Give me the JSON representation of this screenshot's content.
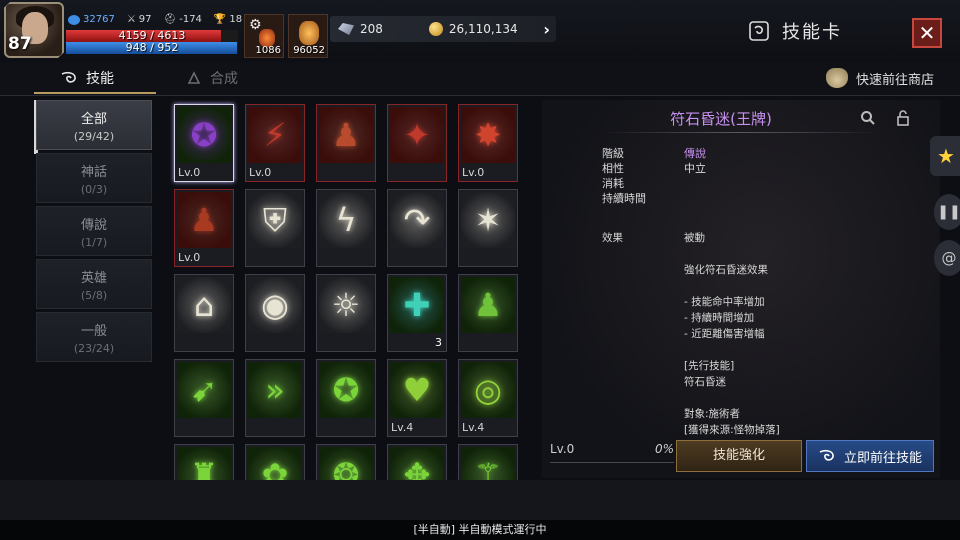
{
  "hud": {
    "level": "87",
    "combat_power": "32767",
    "stat_attack": "97",
    "stat_defense": "-174",
    "stat_trophy": "18",
    "hp_text": "4159 / 4613",
    "hp_fraction": 0.9,
    "mp_text": "948 / 952",
    "mp_fraction": 0.995,
    "potion1_count": "1086",
    "potion2_count": "96052",
    "crystal": "208",
    "gold": "26,110,134"
  },
  "header": {
    "title": "技能卡",
    "close_label": "✕"
  },
  "tabs": [
    {
      "label": "技能",
      "active": true
    },
    {
      "label": "合成",
      "active": false
    }
  ],
  "shop_link": "快速前往商店",
  "categories": [
    {
      "name": "全部",
      "count": "(29/42)",
      "active": true
    },
    {
      "name": "神話",
      "count": "(0/3)",
      "active": false
    },
    {
      "name": "傳說",
      "count": "(1/7)",
      "active": false
    },
    {
      "name": "英雄",
      "count": "(5/8)",
      "active": false
    },
    {
      "name": "一般",
      "count": "(23/24)",
      "active": false
    }
  ],
  "cards": [
    {
      "icon": "rune-purple-icon",
      "lv": "Lv.0",
      "count": "",
      "border": "sel",
      "hue": "#8a3fc7"
    },
    {
      "icon": "red-slash-icon",
      "lv": "Lv.0",
      "count": "",
      "border": "red",
      "hue": "#c0392b"
    },
    {
      "icon": "red-body-icon",
      "lv": "",
      "count": "",
      "border": "red",
      "hue": "#b84a2e"
    },
    {
      "icon": "red-blade-icon",
      "lv": "",
      "count": "",
      "border": "red",
      "hue": "#c0392b"
    },
    {
      "icon": "red-sword-burst-icon",
      "lv": "Lv.0",
      "count": "",
      "border": "red",
      "hue": "#d0442e"
    },
    {
      "icon": "red-aura-body-icon",
      "lv": "Lv.0",
      "count": "",
      "border": "red",
      "hue": "#a83a22"
    },
    {
      "icon": "shield-icon",
      "lv": "",
      "count": "",
      "border": "",
      "hue": "#e8e4d4"
    },
    {
      "icon": "lightning-icon",
      "lv": "",
      "count": "",
      "border": "",
      "hue": "#e8e4d4"
    },
    {
      "icon": "curve-arrow-icon",
      "lv": "",
      "count": "",
      "border": "",
      "hue": "#e8e4d4"
    },
    {
      "icon": "star-burst-icon",
      "lv": "",
      "count": "",
      "border": "",
      "hue": "#e8e4d4"
    },
    {
      "icon": "pedestal-icon",
      "lv": "",
      "count": "",
      "border": "",
      "hue": "#e8e4d4"
    },
    {
      "icon": "eye-icon",
      "lv": "",
      "count": "",
      "border": "",
      "hue": "#e8e4d4"
    },
    {
      "icon": "sun-gear-icon",
      "lv": "",
      "count": "",
      "border": "",
      "hue": "#e8e4d4"
    },
    {
      "icon": "teal-sword-icon",
      "lv": "",
      "count": "3",
      "border": "",
      "hue": "#3fd1b8"
    },
    {
      "icon": "green-body-icon",
      "lv": "",
      "count": "",
      "border": "",
      "hue": "#6fc23a"
    },
    {
      "icon": "green-runner-icon",
      "lv": "",
      "count": "",
      "border": "",
      "hue": "#7ad43a"
    },
    {
      "icon": "green-chevron-icon",
      "lv": "",
      "count": "",
      "border": "",
      "hue": "#7ad43a"
    },
    {
      "icon": "green-rune-icon",
      "lv": "",
      "count": "",
      "border": "",
      "hue": "#7ad43a"
    },
    {
      "icon": "green-heart-icon",
      "lv": "Lv.4",
      "count": "",
      "border": "",
      "hue": "#8fd03a"
    },
    {
      "icon": "green-swirl-icon",
      "lv": "Lv.4",
      "count": "",
      "border": "",
      "hue": "#8fd03a"
    },
    {
      "icon": "green-crowd-icon",
      "lv": "",
      "count": "",
      "border": "",
      "hue": "#7ad43a"
    },
    {
      "icon": "green-flower-icon",
      "lv": "",
      "count": "",
      "border": "",
      "hue": "#7ad43a"
    },
    {
      "icon": "green-emblem-icon",
      "lv": "",
      "count": "",
      "border": "",
      "hue": "#7ad43a"
    },
    {
      "icon": "green-creature-icon",
      "lv": "",
      "count": "",
      "border": "",
      "hue": "#7ad43a"
    },
    {
      "icon": "green-staff-icon",
      "lv": "",
      "count": "",
      "border": "",
      "hue": "#7ad43a"
    }
  ],
  "detail": {
    "name": "符石昏迷(王牌)",
    "grade_key": "階級",
    "grade_val": "傳說",
    "attr_key": "相性",
    "attr_val": "中立",
    "cost_key": "消耗",
    "cost_val": "",
    "duration_key": "持續時間",
    "duration_val": "",
    "effect_key": "效果",
    "effect_type": "被動",
    "effect_lines": [
      "",
      "強化符石昏迷效果",
      "",
      "- 技能命中率增加",
      "- 持續時間增加",
      "- 近距離傷害增幅",
      "",
      "[先行技能]",
      "符石昏迷",
      "",
      "對象:施術者",
      "[獲得來源:怪物掉落]"
    ],
    "level": "Lv.0",
    "percent": "0%",
    "enhance_label": "技能強化",
    "goto_label": "立即前往技能"
  },
  "status_bar": "[半自動] 半自動模式運行中"
}
